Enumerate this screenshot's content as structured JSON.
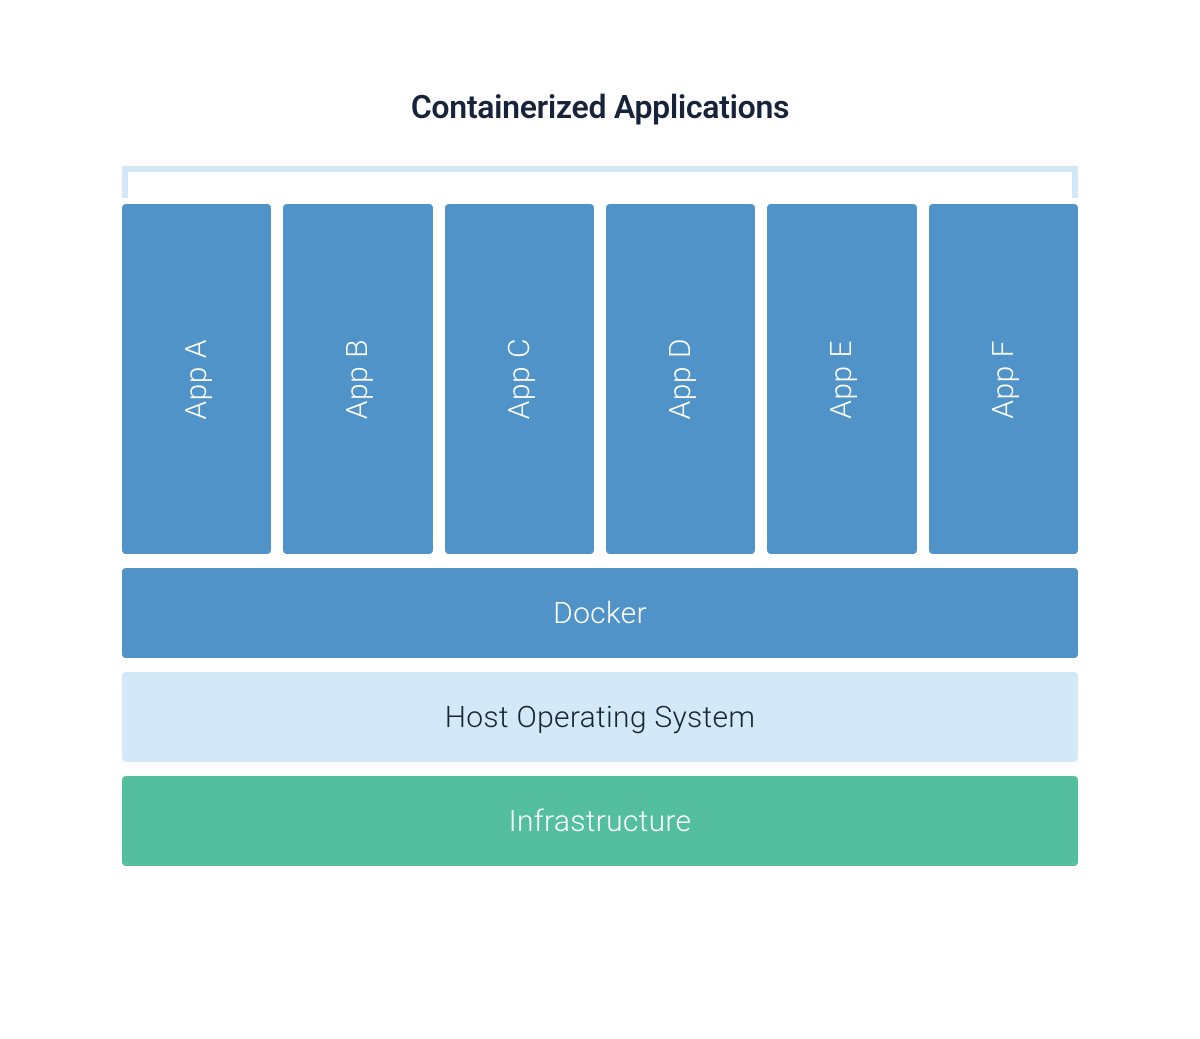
{
  "title": "Containerized Applications",
  "apps": [
    {
      "label": "App A"
    },
    {
      "label": "App B"
    },
    {
      "label": "App C"
    },
    {
      "label": "App D"
    },
    {
      "label": "App E"
    },
    {
      "label": "App F"
    }
  ],
  "layers": {
    "docker": "Docker",
    "host_os": "Host Operating System",
    "infrastructure": "Infrastructure"
  },
  "colors": {
    "app_box": "#4f93c9",
    "docker": "#4f93c9",
    "host_os_bg": "#d4e9f7",
    "host_os_text": "#16233b",
    "infrastructure": "#53bf9d",
    "bracket": "#d3e8f7",
    "title_text": "#16233b"
  }
}
